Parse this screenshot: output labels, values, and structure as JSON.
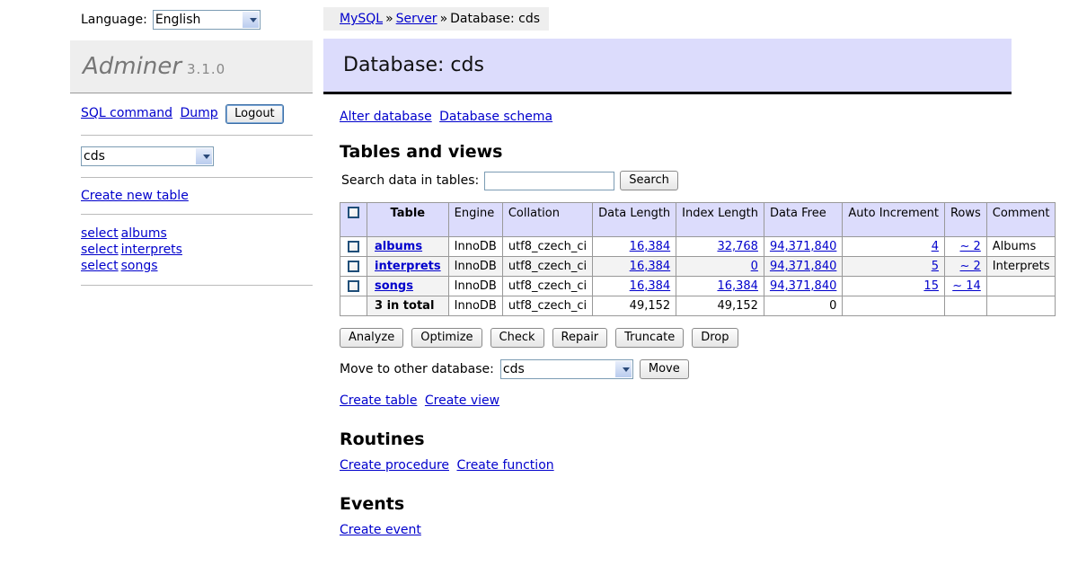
{
  "sidebar": {
    "language_label": "Language:",
    "language_value": "English",
    "language_options": [
      "English"
    ],
    "brand_name": "Adminer",
    "brand_version": "3.1.0",
    "sql_command_link": "SQL command",
    "dump_link": "Dump",
    "logout_button": "Logout",
    "database_value": "cds",
    "database_options": [
      "cds"
    ],
    "create_new_table_link": "Create new table",
    "tables": [
      {
        "select_label": "select",
        "name": "albums"
      },
      {
        "select_label": "select",
        "name": "interprets"
      },
      {
        "select_label": "select",
        "name": "songs"
      }
    ]
  },
  "breadcrumb": {
    "items": [
      "MySQL",
      "Server"
    ],
    "separator": "»",
    "current": "Database: cds"
  },
  "header": {
    "title": "Database: cds"
  },
  "top_links": {
    "alter_database": "Alter database",
    "database_schema": "Database schema"
  },
  "tables_section": {
    "heading": "Tables and views",
    "search_label": "Search data in tables:",
    "search_value": "",
    "search_placeholder": "",
    "search_button": "Search",
    "columns": [
      "Table",
      "Engine",
      "Collation",
      "Data Length",
      "Index Length",
      "Data Free",
      "Auto Increment",
      "Rows",
      "Comment"
    ],
    "rows": [
      {
        "name": "albums",
        "engine": "InnoDB",
        "collation": "utf8_czech_ci",
        "data_length": "16,384",
        "index_length": "32,768",
        "data_free": "94,371,840",
        "auto_increment": "4",
        "rows": "~ 2",
        "comment": "Albums"
      },
      {
        "name": "interprets",
        "engine": "InnoDB",
        "collation": "utf8_czech_ci",
        "data_length": "16,384",
        "index_length": "0",
        "data_free": "94,371,840",
        "auto_increment": "5",
        "rows": "~ 2",
        "comment": "Interprets"
      },
      {
        "name": "songs",
        "engine": "InnoDB",
        "collation": "utf8_czech_ci",
        "data_length": "16,384",
        "index_length": "16,384",
        "data_free": "94,371,840",
        "auto_increment": "15",
        "rows": "~ 14",
        "comment": ""
      }
    ],
    "total_row": {
      "name": "3 in total",
      "engine": "InnoDB",
      "collation": "utf8_czech_ci",
      "data_length": "49,152",
      "index_length": "49,152",
      "data_free": "0"
    },
    "actions": [
      "Analyze",
      "Optimize",
      "Check",
      "Repair",
      "Truncate",
      "Drop"
    ],
    "move_label": "Move to other database:",
    "move_value": "cds",
    "move_options": [
      "cds"
    ],
    "move_button": "Move",
    "create_table_link": "Create table",
    "create_view_link": "Create view"
  },
  "routines_section": {
    "heading": "Routines",
    "create_procedure_link": "Create procedure",
    "create_function_link": "Create function"
  },
  "events_section": {
    "heading": "Events",
    "create_event_link": "Create event"
  },
  "colors": {
    "banner_bg": "#dcdcfc",
    "header_bg": "#dcdcfc",
    "link": "#0000cc",
    "sidebar_brand_bg": "#eeeeee",
    "row_alt_bg": "#f3f3f3"
  }
}
